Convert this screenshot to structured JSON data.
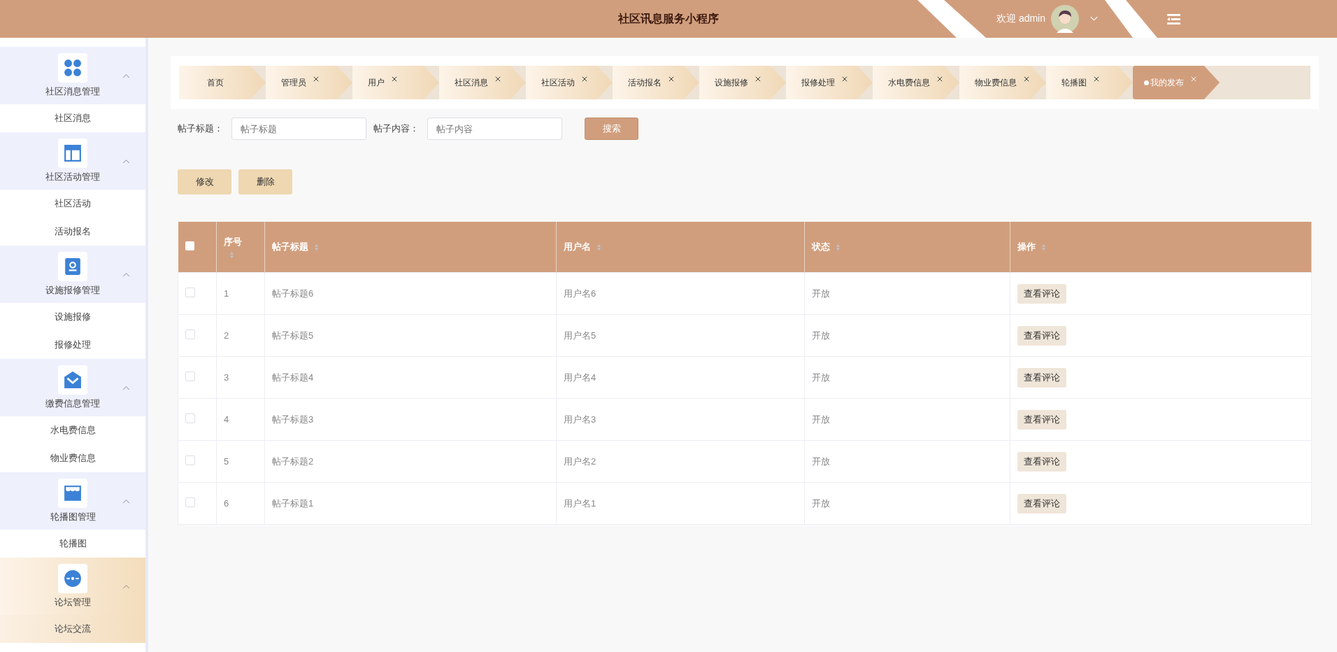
{
  "header": {
    "title": "社区讯息服务小程序",
    "welcome": "欢迎 admin"
  },
  "sidebar": {
    "groups": [
      {
        "label": "社区消息管理",
        "expanded": true,
        "items": [
          {
            "label": "社区消息",
            "selected": false
          }
        ]
      },
      {
        "label": "社区活动管理",
        "expanded": true,
        "items": [
          {
            "label": "社区活动",
            "selected": false
          },
          {
            "label": "活动报名",
            "selected": false
          }
        ]
      },
      {
        "label": "设施报修管理",
        "expanded": true,
        "items": [
          {
            "label": "设施报修",
            "selected": false
          },
          {
            "label": "报修处理",
            "selected": false
          }
        ]
      },
      {
        "label": "缴费信息管理",
        "expanded": true,
        "items": [
          {
            "label": "水电费信息",
            "selected": false
          },
          {
            "label": "物业费信息",
            "selected": false
          }
        ]
      },
      {
        "label": "轮播图管理",
        "expanded": true,
        "items": [
          {
            "label": "轮播图",
            "selected": false
          }
        ]
      },
      {
        "label": "论坛管理",
        "expanded": true,
        "items": [
          {
            "label": "论坛交流",
            "selected": true
          }
        ]
      }
    ]
  },
  "tabs": [
    {
      "label": "首页",
      "closable": false,
      "selected": false
    },
    {
      "label": "管理员",
      "closable": true,
      "selected": false
    },
    {
      "label": "用户",
      "closable": true,
      "selected": false
    },
    {
      "label": "社区消息",
      "closable": true,
      "selected": false
    },
    {
      "label": "社区活动",
      "closable": true,
      "selected": false
    },
    {
      "label": "活动报名",
      "closable": true,
      "selected": false
    },
    {
      "label": "设施报修",
      "closable": true,
      "selected": false
    },
    {
      "label": "报修处理",
      "closable": true,
      "selected": false
    },
    {
      "label": "水电费信息",
      "closable": true,
      "selected": false
    },
    {
      "label": "物业费信息",
      "closable": true,
      "selected": false
    },
    {
      "label": "轮播图",
      "closable": true,
      "selected": false
    },
    {
      "label": "我的发布",
      "closable": true,
      "selected": true
    }
  ],
  "search": {
    "fields": [
      {
        "label": "帖子标题：",
        "placeholder": "帖子标题"
      },
      {
        "label": "帖子内容：",
        "placeholder": "帖子内容"
      }
    ],
    "button": "搜索"
  },
  "actions": [
    "修改",
    "删除"
  ],
  "table": {
    "columns": [
      {
        "label": "序号"
      },
      {
        "label": "帖子标题"
      },
      {
        "label": "用户名"
      },
      {
        "label": "状态"
      },
      {
        "label": "操作"
      }
    ],
    "select_all_checked": false,
    "rows": [
      {
        "checked": false,
        "cells": [
          "1",
          "帖子标题6",
          "用户名6",
          "开放"
        ],
        "action": "查看评论"
      },
      {
        "checked": false,
        "cells": [
          "2",
          "帖子标题5",
          "用户名5",
          "开放"
        ],
        "action": "查看评论"
      },
      {
        "checked": false,
        "cells": [
          "3",
          "帖子标题4",
          "用户名4",
          "开放"
        ],
        "action": "查看评论"
      },
      {
        "checked": false,
        "cells": [
          "4",
          "帖子标题3",
          "用户名3",
          "开放"
        ],
        "action": "查看评论"
      },
      {
        "checked": false,
        "cells": [
          "5",
          "帖子标题2",
          "用户名2",
          "开放"
        ],
        "action": "查看评论"
      },
      {
        "checked": false,
        "cells": [
          "6",
          "帖子标题1",
          "用户名1",
          "开放"
        ],
        "action": "查看评论"
      }
    ]
  }
}
